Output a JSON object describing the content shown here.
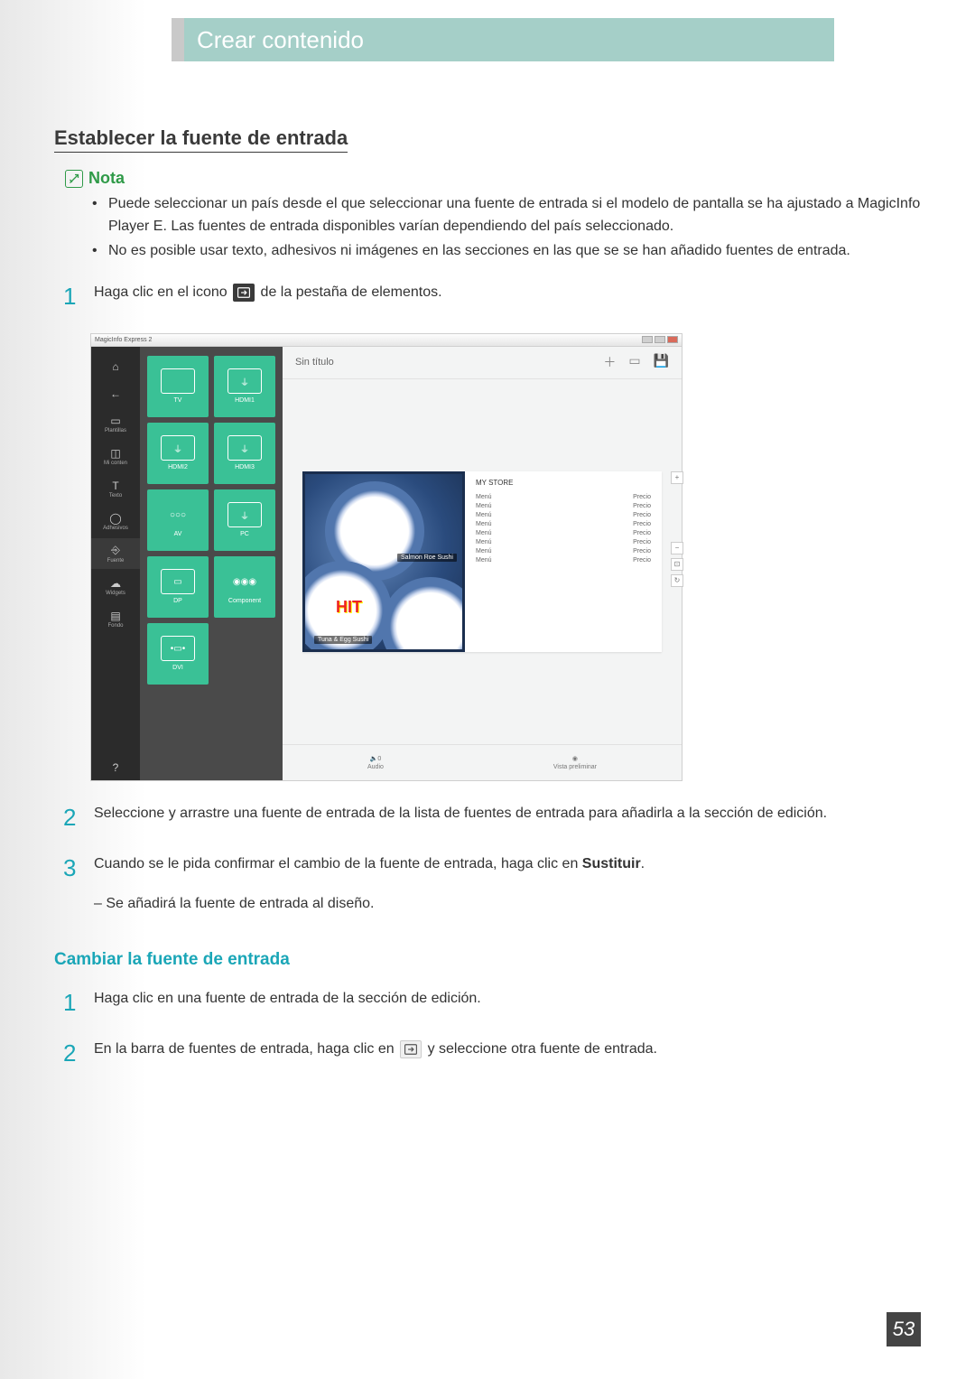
{
  "banner": {
    "title": "Crear contenido"
  },
  "section": {
    "heading": "Establecer la fuente de entrada"
  },
  "nota": {
    "label": "Nota",
    "bullets": [
      "Puede seleccionar un país desde el que seleccionar una fuente de entrada si el modelo de pantalla se ha ajustado a MagicInfo Player E. Las fuentes de entrada disponibles varían dependiendo del país seleccionado.",
      "No es posible usar texto, adhesivos ni imágenes en las secciones en las que se se han añadido fuentes de entrada."
    ]
  },
  "steps": {
    "s1_pre": "Haga clic en el icono",
    "s1_post": " de la pestaña de elementos.",
    "s2": "Seleccione y arrastre una fuente de entrada de la lista de fuentes de entrada para añadirla a la sección de edición.",
    "s3_pre": "Cuando se le pida confirmar el cambio de la fuente de entrada, haga clic en ",
    "s3_bold": "Sustituir",
    "s3_dash": "– Se añadirá la fuente de entrada al diseño.",
    "n1": "1",
    "n2": "2",
    "n3": "3"
  },
  "sub": {
    "heading": "Cambiar la fuente de entrada",
    "s1": "Haga clic en una fuente de entrada de la sección de edición.",
    "s2_pre": "En la barra de fuentes de entrada, haga clic en ",
    "s2_post": " y seleccione otra fuente de entrada.",
    "n1": "1",
    "n2": "2"
  },
  "figure": {
    "win_title": "MagicInfo Express 2",
    "canvas_title": "Sin título",
    "rail": [
      "",
      "",
      "Plantillas",
      "Mi conten",
      "Texto",
      "Adhesivos",
      "Fuente",
      "Widgets",
      "Fondo"
    ],
    "palette": [
      "TV",
      "HDMI1",
      "HDMI2",
      "HDMI3",
      "AV",
      "PC",
      "DP",
      "Component",
      "DVI"
    ],
    "layout": {
      "title": "MY STORE",
      "sushi1": "Salmon Roe Sushi",
      "sushi2": "Tuna & Egg Sushi",
      "hit": "HIT",
      "col1": "Menú",
      "col2": "Precio",
      "rows": 8
    },
    "bottom": {
      "audio": "Audio",
      "audio_count": "0",
      "preview": "Vista preliminar"
    }
  },
  "page": "53"
}
